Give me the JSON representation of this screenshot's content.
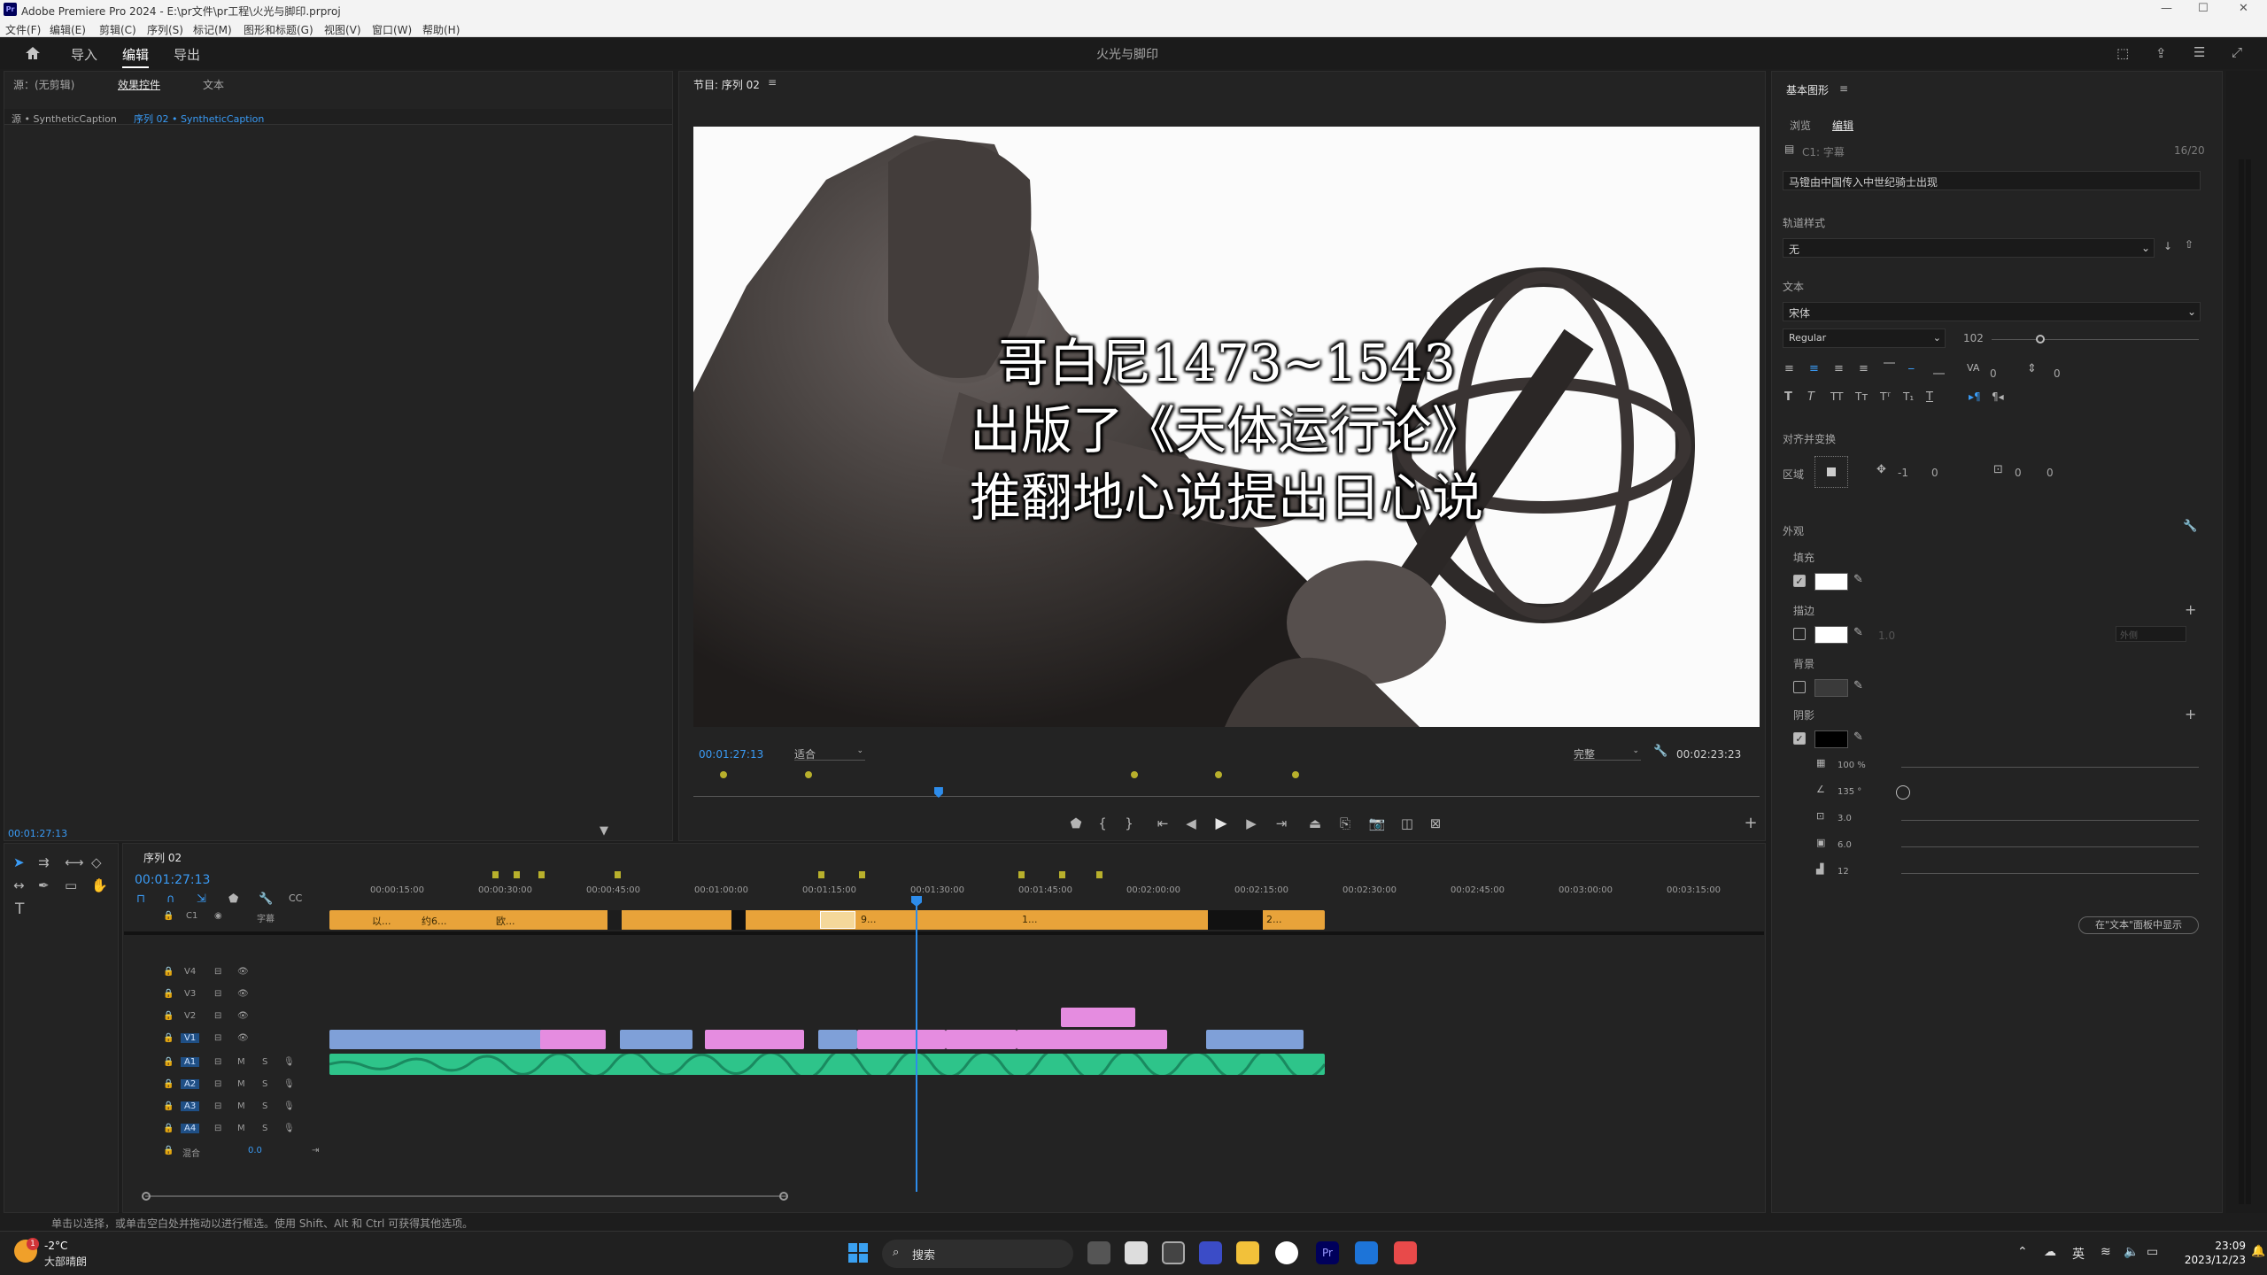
{
  "titlebar": {
    "logo": "Pr",
    "title": "Adobe Premiere Pro 2024 - E:\\pr文件\\pr工程\\火光与脚印.prproj",
    "minimize": "—",
    "maximize": "☐",
    "close": "✕"
  },
  "menu": [
    "文件(F)",
    "编辑(E)",
    "剪辑(C)",
    "序列(S)",
    "标记(M)",
    "图形和标题(G)",
    "视图(V)",
    "窗口(W)",
    "帮助(H)"
  ],
  "header": {
    "home_icon": "home-icon",
    "workspaces": [
      "导入",
      "编辑",
      "导出"
    ],
    "project_title": "火光与脚印"
  },
  "source_panel": {
    "tabs": [
      "源：(无剪辑)",
      "效果控件",
      "文本"
    ],
    "source_clip": "源 • SyntheticCaption",
    "sequence_clip": "序列 02 • SyntheticCaption",
    "timecode": "00:01:27:13"
  },
  "program_monitor": {
    "tab": "节目: 序列 02",
    "caption_lines": [
      "哥白尼1473~1543",
      "出版了《天体运行论》",
      "推翻地心说提出日心说"
    ],
    "timecode": "00:01:27:13",
    "fit": "适合",
    "quality": "完整",
    "duration": "00:02:23:23",
    "playhead_fraction": 0.23
  },
  "timeline": {
    "tab": "序列 02",
    "timecode": "00:01:27:13",
    "ruler": [
      "00:00:15:00",
      "00:00:30:00",
      "00:00:45:00",
      "00:01:00:00",
      "00:01:15:00",
      "00:01:30:00",
      "00:01:45:00",
      "00:02:00:00",
      "00:02:15:00",
      "00:02:30:00",
      "00:02:45:00",
      "00:03:00:00",
      "00:03:15:00"
    ],
    "caption_track": {
      "id": "C1",
      "name": "字幕",
      "clip_labels": [
        "以...",
        "约6...",
        "欧...",
        "9...",
        "1...",
        "2..."
      ]
    },
    "video_tracks": [
      "V4",
      "V3",
      "V2",
      "V1"
    ],
    "audio_tracks": [
      "A1",
      "A2",
      "A3",
      "A4"
    ],
    "mix_label": "混合",
    "mix_value": "0.0"
  },
  "essential_graphics": {
    "title": "基本图形",
    "tabs": [
      "浏览",
      "编辑"
    ],
    "layer": "C1: 字幕",
    "char_count": "16/20",
    "caption_text": "马镫由中国传入中世纪骑士出现",
    "track_style_label": "轨道样式",
    "track_style": "无",
    "text_label": "文本",
    "font": "宋体",
    "font_style": "Regular",
    "font_size": "102",
    "spacing_values": [
      "0",
      "0"
    ],
    "align_label": "对齐并变换",
    "region_label": "区域",
    "position": [
      "-1",
      "0"
    ],
    "scale": [
      "0",
      "0"
    ],
    "appearance_label": "外观",
    "fill_label": "填充",
    "stroke_label": "描边",
    "background_label": "背景",
    "shadow_label": "阴影",
    "stroke_width": "1.0",
    "stroke_position": "外侧",
    "shadow": {
      "opacity": "100 %",
      "angle": "135 °",
      "distance": "3.0",
      "size": "6.0",
      "blur": "12"
    },
    "colors": {
      "fill": "#ffffff",
      "stroke": "#ffffff",
      "background": "#3a3a3a",
      "shadow": "#000000"
    },
    "show_in_text_panel": "在\"文本\"面板中显示"
  },
  "status_bar": {
    "hint": "单击以选择，或单击空白处并拖动以进行框选。使用 Shift、Alt 和 Ctrl 可获得其他选项。"
  },
  "taskbar": {
    "weather_temp": "-2°C",
    "weather_desc": "大部晴朗",
    "weather_badge": "1",
    "search": "搜索",
    "ime": "英",
    "time": "23:09",
    "date": "2023/12/23"
  },
  "colors": {
    "caption_clip": "#e8a33a",
    "video_clip_blue": "#7fa0d8",
    "video_clip_pink": "#e58ce0",
    "audio_clip": "#2ec48a",
    "accent": "#2d8ceb"
  }
}
